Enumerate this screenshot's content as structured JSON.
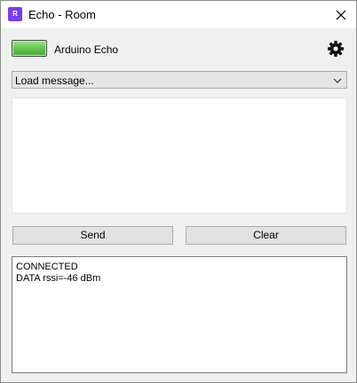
{
  "window": {
    "icon_letter": "R",
    "title": "Echo - Room",
    "close_icon": "close-icon"
  },
  "device": {
    "status_led_color": "#5fc24c",
    "name": "Arduino Echo",
    "settings_icon": "gear-icon"
  },
  "message_select": {
    "selected": "Load message...",
    "arrow_icon": "chevron-down-icon"
  },
  "message_input": {
    "value": ""
  },
  "buttons": {
    "send_label": "Send",
    "clear_label": "Clear"
  },
  "log": {
    "lines": [
      "CONNECTED",
      "DATA rssi=-46 dBm"
    ]
  }
}
